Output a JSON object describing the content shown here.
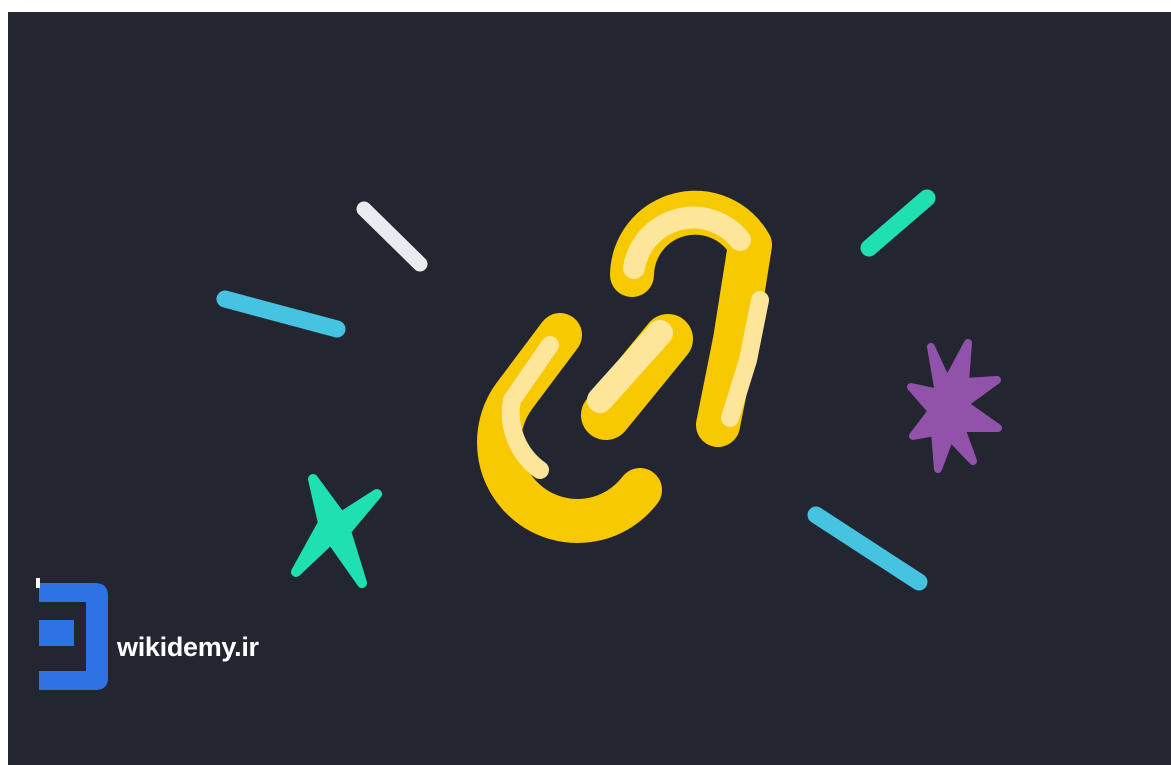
{
  "scene": {
    "subject": "chain-link-icon",
    "decorations": [
      "dash",
      "dash",
      "dash",
      "dash",
      "dash",
      "four-point-star",
      "eight-point-star"
    ]
  },
  "colors": {
    "background": "#232630",
    "link_dark": "#f7c900",
    "link_light": "#fde59a",
    "cyan": "#45c3e0",
    "green": "#1fe0b1",
    "white": "#e8ecef",
    "purple": "#9153a9",
    "brand_blue": "#2f72e6",
    "brand_text": "#ffffff"
  },
  "watermark": {
    "icon": "wikidemy-logo-icon",
    "text": "wikidemy.ir"
  }
}
